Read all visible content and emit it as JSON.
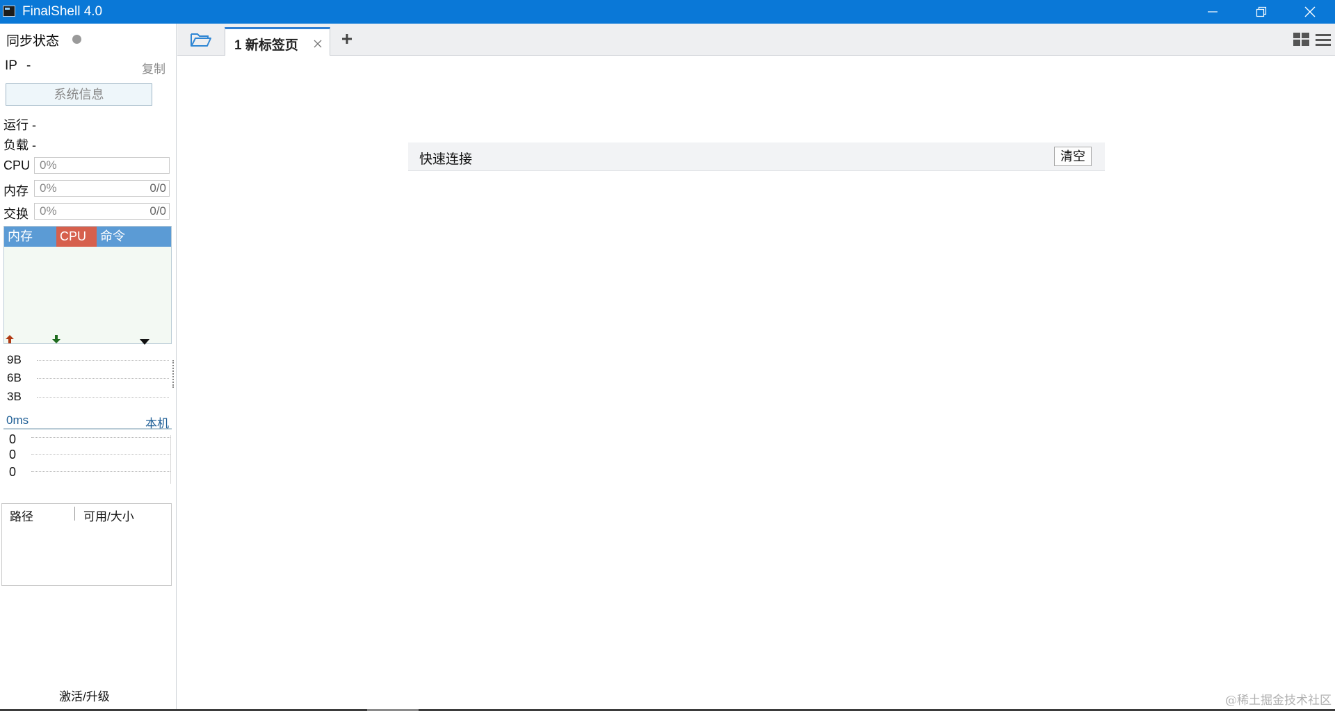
{
  "window": {
    "title": "FinalShell 4.0"
  },
  "sidebar": {
    "sync_label": "同步状态",
    "ip_label": "IP",
    "ip_value": "-",
    "copy_label": "复制",
    "sysinfo_button": "系统信息",
    "uptime_label": "运行 -",
    "load_label": "负载 -",
    "cpu": {
      "label": "CPU",
      "percent": "0%"
    },
    "memory": {
      "label": "内存",
      "percent": "0%",
      "amount": "0/0"
    },
    "swap": {
      "label": "交换",
      "percent": "0%",
      "amount": "0/0"
    },
    "process_tabs": {
      "mem": "内存",
      "cpu": "CPU",
      "cmd": "命令"
    },
    "network": {
      "y_labels": [
        "9B",
        "6B",
        "3B"
      ]
    },
    "ping": {
      "latency": "0ms",
      "host": "本机",
      "y_labels": [
        "0",
        "0",
        "0"
      ]
    },
    "disk": {
      "col_path": "路径",
      "col_avail": "可用/大小"
    },
    "activate_link": "激活/升级"
  },
  "tabs": [
    {
      "label": "1 新标签页",
      "active": true
    }
  ],
  "main": {
    "quick_connect_label": "快速连接",
    "clear_button": "清空",
    "watermark": "@稀土掘金技术社区"
  },
  "colors": {
    "titlebar": "#0a78d7",
    "process_header": "#5b9bd5",
    "cpu_tab": "#d6604d",
    "upload_arrow": "#b03a14",
    "download_arrow": "#1e6b1e"
  }
}
